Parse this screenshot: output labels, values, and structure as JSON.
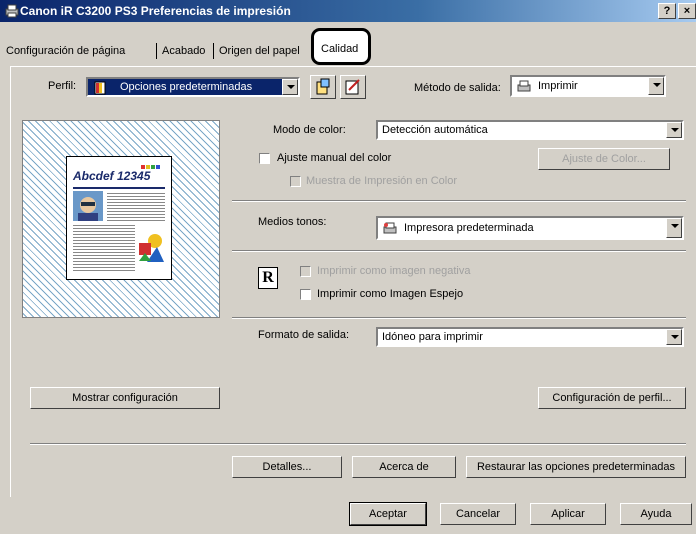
{
  "window": {
    "title": "Canon iR C3200 PS3 Preferencias de impresión",
    "help_btn": "?",
    "close_btn": "×"
  },
  "tabs": [
    {
      "label": "Configuración de página"
    },
    {
      "label": "Acabado"
    },
    {
      "label": "Origen del papel"
    },
    {
      "label": "Calidad"
    }
  ],
  "profile": {
    "label": "Perfil:",
    "value": "Opciones predeterminadas"
  },
  "output_method": {
    "label": "Método de salida:",
    "value": "Imprimir"
  },
  "preview": {
    "sample_title": "Abcdef 12345"
  },
  "color_mode": {
    "label": "Modo de color:",
    "value": "Detección automática"
  },
  "manual_color": {
    "label": "Ajuste manual del color",
    "button": "Ajuste de Color..."
  },
  "color_sample": {
    "label": "Muestra de Impresión en Color"
  },
  "halftones": {
    "label": "Medios tonos:",
    "value": "Impresora predeterminada"
  },
  "negative": {
    "label": "Imprimir como imagen negativa",
    "icon_glyph": "R"
  },
  "mirror": {
    "label": "Imprimir como Imagen Espejo"
  },
  "output_format": {
    "label": "Formato de salida:",
    "value": "Idóneo para imprimir"
  },
  "buttons": {
    "show_config": "Mostrar configuración",
    "profile_config": "Configuración de perfil...",
    "details": "Detalles...",
    "about": "Acerca de",
    "restore": "Restaurar las opciones predeterminadas",
    "ok": "Aceptar",
    "cancel": "Cancelar",
    "apply": "Aplicar",
    "help": "Ayuda"
  }
}
